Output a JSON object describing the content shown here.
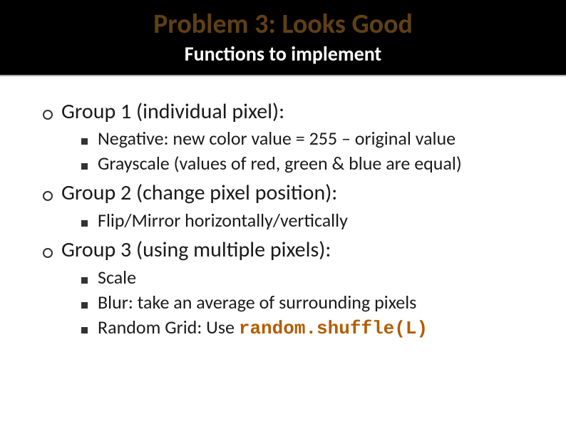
{
  "header": {
    "title": "Problem 3: Looks Good",
    "subtitle": "Functions to implement"
  },
  "groups": [
    {
      "heading": "Group 1 (individual pixel):",
      "items": [
        {
          "text": "Negative: new color value = 255 – original value"
        },
        {
          "text": "Grayscale (values of red, green & blue are equal)"
        }
      ]
    },
    {
      "heading": "Group 2 (change pixel position):",
      "items": [
        {
          "text": "Flip/Mirror horizontally/vertically"
        }
      ]
    },
    {
      "heading": "Group 3 (using multiple pixels):",
      "items": [
        {
          "text": "Scale"
        },
        {
          "text": "Blur: take an average of surrounding pixels"
        },
        {
          "text": "Random Grid: Use ",
          "code": "random.shuffle(L)"
        }
      ]
    }
  ]
}
